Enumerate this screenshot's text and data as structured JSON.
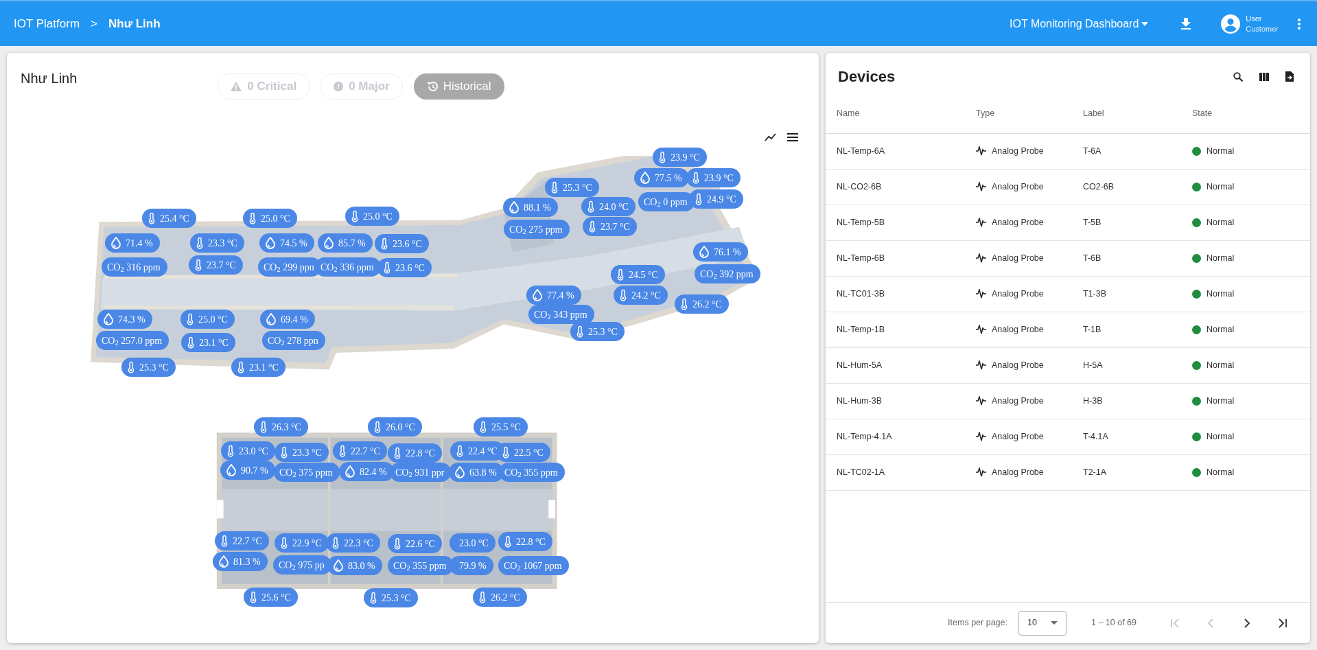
{
  "header": {
    "breadcrumb": [
      {
        "label": "IOT Platform"
      },
      {
        "label": "Như Linh"
      }
    ],
    "separator": ">",
    "dashboard": "IOT Monitoring Dashboard",
    "user": {
      "name": "User",
      "role": "Customer"
    }
  },
  "map": {
    "title": "Như Linh",
    "filters": [
      {
        "kind": "critical",
        "label": "0 Critical",
        "disabled": true
      },
      {
        "kind": "major",
        "label": "0 Major",
        "disabled": true
      },
      {
        "kind": "historical",
        "label": "Historical",
        "disabled": false
      }
    ],
    "sensors": [
      {
        "kind": "temp",
        "text": "25.4 °C"
      },
      {
        "kind": "temp",
        "text": "25.0 °C"
      },
      {
        "kind": "temp",
        "text": "25.0 °C"
      },
      {
        "kind": "hum",
        "text": "71.4 %"
      },
      {
        "kind": "temp",
        "text": "23.3 °C"
      },
      {
        "kind": "hum",
        "text": "74.5 %"
      },
      {
        "kind": "hum",
        "text": "85.7 %"
      },
      {
        "kind": "temp",
        "text": "23.6 °C"
      },
      {
        "kind": "co2",
        "text": "CO$_{2}$ 316 ppm"
      },
      {
        "kind": "temp",
        "text": "23.7 °C"
      },
      {
        "kind": "co2",
        "text": "CO$_{2}$ 299 ppn"
      },
      {
        "kind": "co2",
        "text": "CO$_{2}$ 336 ppm"
      },
      {
        "kind": "temp",
        "text": "23.6 °C"
      },
      {
        "kind": "hum",
        "text": "74.3 %"
      },
      {
        "kind": "temp",
        "text": "25.0 °C"
      },
      {
        "kind": "hum",
        "text": "69.4 %"
      },
      {
        "kind": "co2",
        "text": "CO$_{2}$ 257.0 ppm"
      },
      {
        "kind": "temp",
        "text": "23.1 °C"
      },
      {
        "kind": "co2",
        "text": "CO$_{2}$ 278 ppn"
      },
      {
        "kind": "temp",
        "text": "25.3 °C"
      },
      {
        "kind": "temp",
        "text": "23.1 °C"
      },
      {
        "kind": "temp",
        "text": "23.9 °C"
      },
      {
        "kind": "temp",
        "text": "25.3 °C"
      },
      {
        "kind": "hum",
        "text": "77.5 %"
      },
      {
        "kind": "temp",
        "text": "23.9 °C"
      },
      {
        "kind": "hum",
        "text": "88.1 %"
      },
      {
        "kind": "temp",
        "text": "24.0 °C"
      },
      {
        "kind": "co2",
        "text": "CO$_{2}$ 0 ppm"
      },
      {
        "kind": "temp",
        "text": "24.9 °C"
      },
      {
        "kind": "co2",
        "text": "CO$_{2}$ 275 ppm"
      },
      {
        "kind": "temp",
        "text": "23.7 °C"
      },
      {
        "kind": "hum",
        "text": "76.1 %"
      },
      {
        "kind": "temp",
        "text": "24.5 °C"
      },
      {
        "kind": "co2",
        "text": "CO$_{2}$ 392 ppm"
      },
      {
        "kind": "hum",
        "text": "77.4 %"
      },
      {
        "kind": "temp",
        "text": "24.2 °C"
      },
      {
        "kind": "temp",
        "text": "26.2 °C"
      },
      {
        "kind": "co2",
        "text": "CO$_{2}$ 343 ppm"
      },
      {
        "kind": "temp",
        "text": "25.3 °C"
      },
      {
        "kind": "temp",
        "text": "26.3 °C"
      },
      {
        "kind": "temp",
        "text": "26.0 °C"
      },
      {
        "kind": "temp",
        "text": "25.5 °C"
      },
      {
        "kind": "temp",
        "text": "23.0 °C"
      },
      {
        "kind": "temp",
        "text": "23.3 °C"
      },
      {
        "kind": "temp",
        "text": "22.7 °C"
      },
      {
        "kind": "temp",
        "text": "22.8 °C"
      },
      {
        "kind": "temp",
        "text": "22.4 °C"
      },
      {
        "kind": "temp",
        "text": "22.5 °C"
      },
      {
        "kind": "hum",
        "text": "90.7 %"
      },
      {
        "kind": "co2",
        "text": "CO$_{2}$ 375 ppm"
      },
      {
        "kind": "hum",
        "text": "82.4 %"
      },
      {
        "kind": "co2",
        "text": "CO$_{2}$ 931 ppr"
      },
      {
        "kind": "hum",
        "text": "63.8 %"
      },
      {
        "kind": "co2",
        "text": "CO$_{2}$ 355 ppm"
      },
      {
        "kind": "temp",
        "text": "22.7 °C"
      },
      {
        "kind": "temp",
        "text": "22.9 °C"
      },
      {
        "kind": "temp",
        "text": "22.3 °C"
      },
      {
        "kind": "temp",
        "text": "22.6 °C"
      },
      {
        "kind": "plain",
        "text": "23.0 °C"
      },
      {
        "kind": "temp",
        "text": "22.8 °C"
      },
      {
        "kind": "hum",
        "text": "81.3 %"
      },
      {
        "kind": "co2",
        "text": "CO$_{2}$ 975 pp"
      },
      {
        "kind": "hum",
        "text": "83.0 %"
      },
      {
        "kind": "co2",
        "text": "CO$_{2}$ 355 ppm"
      },
      {
        "kind": "plain",
        "text": "79.9 %"
      },
      {
        "kind": "co2",
        "text": "CO$_{2}$ 1067 ppm"
      },
      {
        "kind": "temp",
        "text": "25.6 °C"
      },
      {
        "kind": "temp",
        "text": "25.3 °C"
      },
      {
        "kind": "temp",
        "text": "26.2 °C"
      }
    ]
  },
  "devices": {
    "title": "Devices",
    "columns": [
      "Name",
      "Type",
      "Label",
      "State"
    ],
    "rows": [
      {
        "name": "NL-Temp-6A",
        "type": "Analog Probe",
        "label": "T-6A",
        "state": "Normal"
      },
      {
        "name": "NL-CO2-6B",
        "type": "Analog Probe",
        "label": "CO2-6B",
        "state": "Normal"
      },
      {
        "name": "NL-Temp-5B",
        "type": "Analog Probe",
        "label": "T-5B",
        "state": "Normal"
      },
      {
        "name": "NL-Temp-6B",
        "type": "Analog Probe",
        "label": "T-6B",
        "state": "Normal"
      },
      {
        "name": "NL-TC01-3B",
        "type": "Analog Probe",
        "label": "T1-3B",
        "state": "Normal"
      },
      {
        "name": "NL-Temp-1B",
        "type": "Analog Probe",
        "label": "T-1B",
        "state": "Normal"
      },
      {
        "name": "NL-Hum-5A",
        "type": "Analog Probe",
        "label": "H-5A",
        "state": "Normal"
      },
      {
        "name": "NL-Hum-3B",
        "type": "Analog Probe",
        "label": "H-3B",
        "state": "Normal"
      },
      {
        "name": "NL-Temp-4.1A",
        "type": "Analog Probe",
        "label": "T-4.1A",
        "state": "Normal"
      },
      {
        "name": "NL-TC02-1A",
        "type": "Analog Probe",
        "label": "T2-1A",
        "state": "Normal"
      }
    ],
    "pagination": {
      "items_per_page_label": "Items per page:",
      "page_size": "10",
      "range": "1 – 10 of 69",
      "nav": [
        {
          "kind": "first",
          "disabled": true
        },
        {
          "kind": "prev",
          "disabled": true
        },
        {
          "kind": "next",
          "disabled": false
        },
        {
          "kind": "last",
          "disabled": false
        }
      ]
    }
  }
}
